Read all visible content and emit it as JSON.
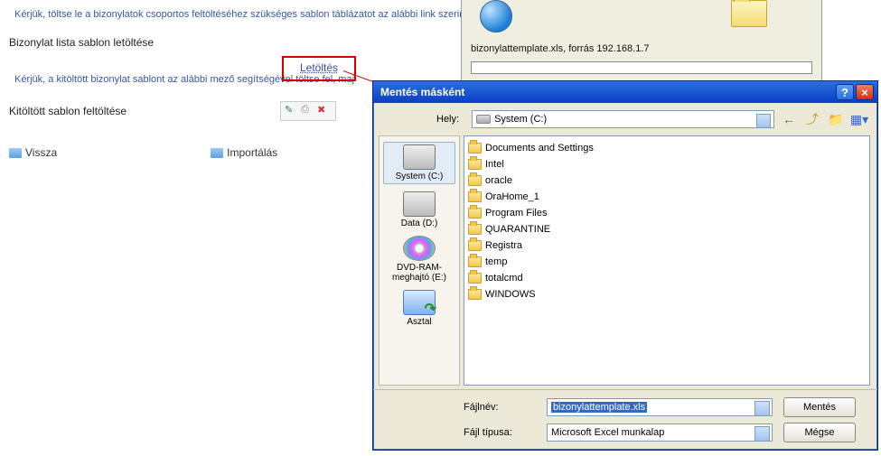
{
  "page": {
    "instruction1": "Kérjük, töltse le a bizonylatok csoportos feltöltéséhez szükséges sablon táblázatot az alábbi link szerint!",
    "row1_label": "Bizonylat lista sablon letöltése",
    "download_link": "Letöltés",
    "instruction2": "Kérjük, a kitöltött bizonylat sablont az alábbi mező segítségével töltse fel, maj",
    "row2_label": "Kitöltött sablon feltöltése",
    "nav_back": "Vissza",
    "nav_import": "Importálás"
  },
  "nsbox": {
    "label": "bizonylattemplate.xls, forrás 192.168.1.7"
  },
  "dialog": {
    "title": "Mentés másként",
    "location_label": "Hely:",
    "location_value": "System (C:)",
    "places": [
      {
        "label": "System (C:)",
        "kind": "drive",
        "selected": true
      },
      {
        "label": "Data (D:)",
        "kind": "drive"
      },
      {
        "label": "DVD-RAM-meghajtó (E:)",
        "kind": "dvd"
      },
      {
        "label": "Asztal",
        "kind": "desktop"
      }
    ],
    "folders": [
      "Documents and Settings",
      "Intel",
      "oracle",
      "OraHome_1",
      "Program Files",
      "QUARANTINE",
      "Registra",
      "temp",
      "totalcmd",
      "WINDOWS"
    ],
    "filename_label": "Fájlnév:",
    "filename_value": "bizonylattemplate.xls",
    "filetype_label": "Fájl típusa:",
    "filetype_value": "Microsoft Excel munkalap",
    "save_button": "Mentés",
    "cancel_button": "Mégse"
  }
}
